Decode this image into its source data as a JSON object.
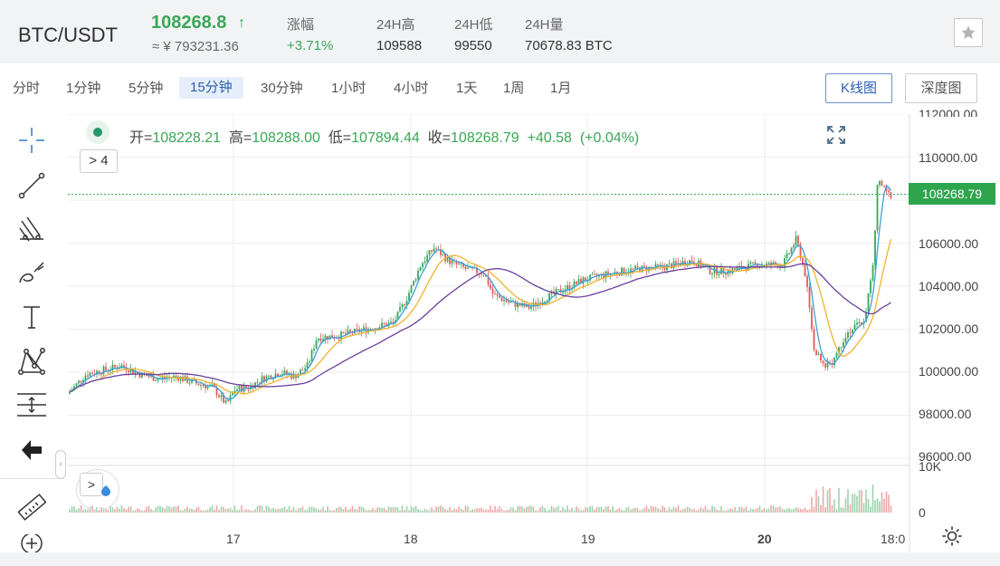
{
  "header": {
    "pair": "BTC/USDT",
    "price": "108268.8",
    "price_arrow": "↑",
    "price_cny": "≈ ¥ 793231.36",
    "stats": [
      {
        "label": "涨幅",
        "value": "+3.71%",
        "green": true
      },
      {
        "label": "24H高",
        "value": "109588"
      },
      {
        "label": "24H低",
        "value": "99550"
      },
      {
        "label": "24H量",
        "value": "70678.83 BTC"
      }
    ],
    "favorite_icon": "star-icon"
  },
  "toolbar": {
    "timeframes": [
      "分时",
      "1分钟",
      "5分钟",
      "15分钟",
      "30分钟",
      "1小时",
      "4小时",
      "1天",
      "1周",
      "1月"
    ],
    "active_timeframe": "15分钟",
    "kline_label": "K线图",
    "depth_label": "深度图"
  },
  "tools": [
    "crosshair-icon",
    "trend-line-icon",
    "pitchfork-icon",
    "brush-icon",
    "text-icon",
    "pattern-icon",
    "measure-icon",
    "back-arrow-icon",
    "ruler-icon",
    "zoom-in-icon"
  ],
  "ohlc": {
    "open_label": "开=",
    "open": "108228.21",
    "high_label": "高=",
    "high": "108288.00",
    "low_label": "低=",
    "low": "107894.44",
    "close_label": "收=",
    "close": "108268.79",
    "change": "+40.58",
    "change_pct": "(+0.04%)"
  },
  "indicator_toggle": "> 4",
  "volume_toggle": ">",
  "last_price_tag": "108268.79",
  "colors": {
    "up": "#3aa657",
    "down": "#e45b5b",
    "ma1": "#3aa0d8",
    "ma2": "#f0b330",
    "ma3": "#6b3fa0"
  },
  "chart_data": {
    "type": "candlestick",
    "y_ticks": [
      "112000.00",
      "110000.00",
      "106000.00",
      "104000.00",
      "102000.00",
      "100000.00",
      "98000.00",
      "96000.00"
    ],
    "ylim": [
      96000,
      112000
    ],
    "volume_ticks": [
      "10K",
      "0"
    ],
    "x_ticks": [
      "17",
      "18",
      "19",
      "20",
      "18:0"
    ],
    "last_price": 108268.79
  }
}
